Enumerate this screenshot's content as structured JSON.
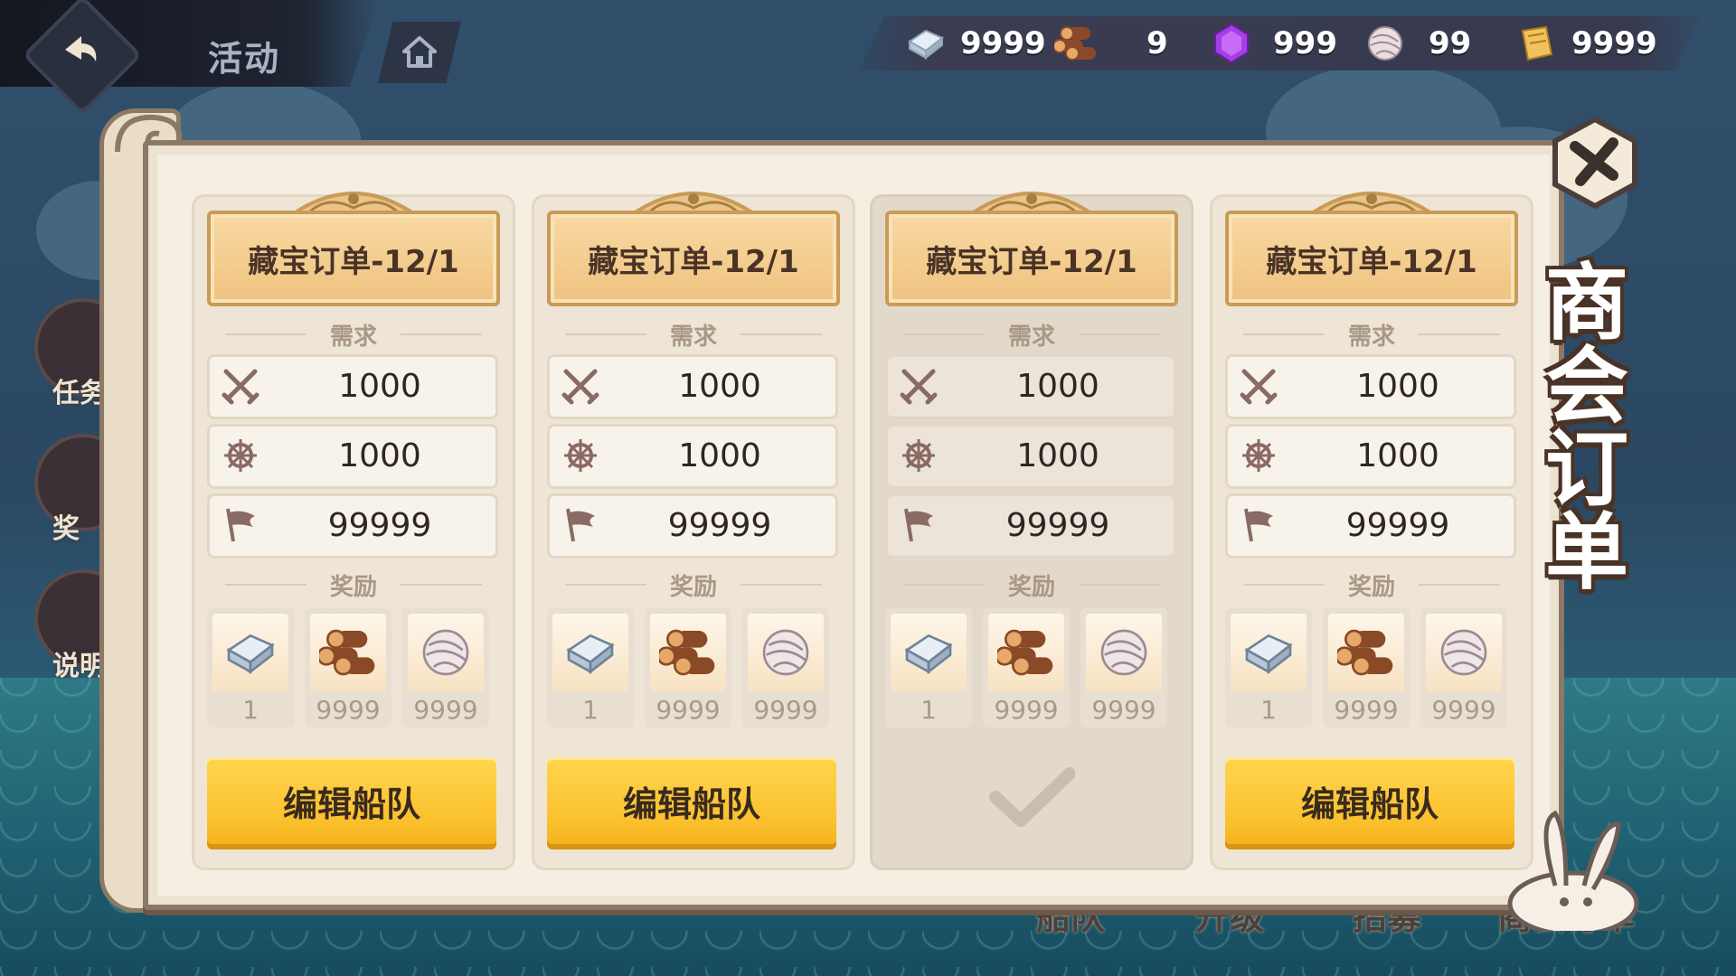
{
  "header": {
    "tab_title": "活动"
  },
  "resources": [
    {
      "icon": "silver-ingot-icon",
      "value": "9999"
    },
    {
      "icon": "wood-logs-icon",
      "value": "9"
    },
    {
      "icon": "purple-gem-icon",
      "value": "999"
    },
    {
      "icon": "yarn-ball-icon",
      "value": "99"
    },
    {
      "icon": "scroll-icon",
      "value": "9999"
    }
  ],
  "side_menu": [
    "任务",
    "奖",
    "说明"
  ],
  "bottom_nav": [
    "船队",
    "升级",
    "招募",
    "商会订单"
  ],
  "panel": {
    "title": "商会订单"
  },
  "orders": [
    {
      "title": "藏宝订单-12/1",
      "require_label": "需求",
      "requirements": [
        {
          "icon": "crossed-swords-icon",
          "value": "1000"
        },
        {
          "icon": "ship-wheel-icon",
          "value": "1000"
        },
        {
          "icon": "flag-icon",
          "value": "99999"
        }
      ],
      "reward_label": "奖励",
      "rewards": [
        {
          "icon": "silver-ingot-icon",
          "count": "1"
        },
        {
          "icon": "wood-logs-icon",
          "count": "9999"
        },
        {
          "icon": "yarn-ball-icon",
          "count": "9999"
        }
      ],
      "action_label": "编辑船队",
      "completed": false
    },
    {
      "title": "藏宝订单-12/1",
      "require_label": "需求",
      "requirements": [
        {
          "icon": "crossed-swords-icon",
          "value": "1000"
        },
        {
          "icon": "ship-wheel-icon",
          "value": "1000"
        },
        {
          "icon": "flag-icon",
          "value": "99999"
        }
      ],
      "reward_label": "奖励",
      "rewards": [
        {
          "icon": "silver-ingot-icon",
          "count": "1"
        },
        {
          "icon": "wood-logs-icon",
          "count": "9999"
        },
        {
          "icon": "yarn-ball-icon",
          "count": "9999"
        }
      ],
      "action_label": "编辑船队",
      "completed": false
    },
    {
      "title": "藏宝订单-12/1",
      "require_label": "需求",
      "requirements": [
        {
          "icon": "crossed-swords-icon",
          "value": "1000"
        },
        {
          "icon": "ship-wheel-icon",
          "value": "1000"
        },
        {
          "icon": "flag-icon",
          "value": "99999"
        }
      ],
      "reward_label": "奖励",
      "rewards": [
        {
          "icon": "silver-ingot-icon",
          "count": "1"
        },
        {
          "icon": "wood-logs-icon",
          "count": "9999"
        },
        {
          "icon": "yarn-ball-icon",
          "count": "9999"
        }
      ],
      "action_label": "",
      "completed": true
    },
    {
      "title": "藏宝订单-12/1",
      "require_label": "需求",
      "requirements": [
        {
          "icon": "crossed-swords-icon",
          "value": "1000"
        },
        {
          "icon": "ship-wheel-icon",
          "value": "1000"
        },
        {
          "icon": "flag-icon",
          "value": "99999"
        }
      ],
      "reward_label": "奖励",
      "rewards": [
        {
          "icon": "silver-ingot-icon",
          "count": "1"
        },
        {
          "icon": "wood-logs-icon",
          "count": "9999"
        },
        {
          "icon": "yarn-ball-icon",
          "count": "9999"
        }
      ],
      "action_label": "编辑船队",
      "completed": false
    }
  ],
  "colors": {
    "button_yellow": "#fbc22f",
    "title_plate": "#efc27f",
    "panel_bg": "#f5efe3",
    "dark_text": "#4a3326"
  }
}
